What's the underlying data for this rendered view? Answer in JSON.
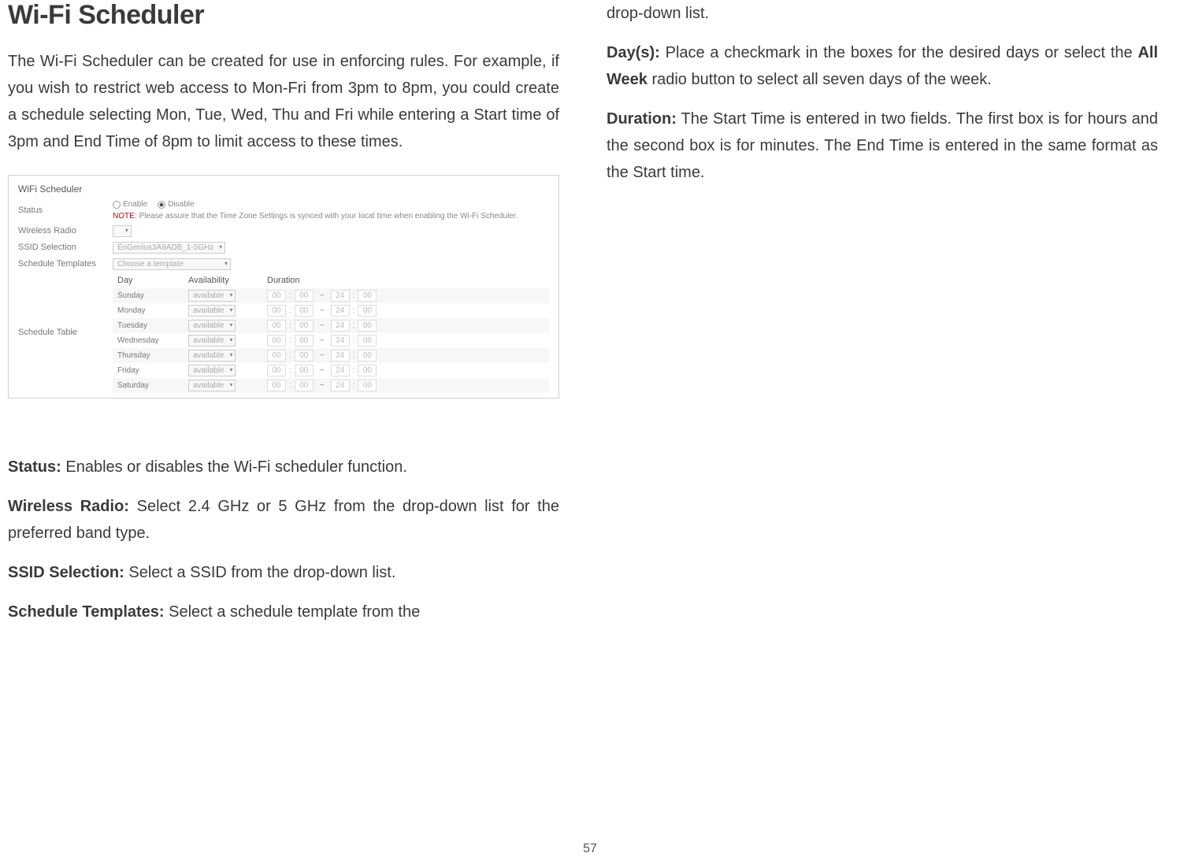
{
  "left": {
    "heading": "Wi-Fi Scheduler",
    "intro": "The Wi-Fi Scheduler can be created for use in enforcing rules. For example, if you wish to restrict web access to Mon-Fri from 3pm to 8pm, you could create a schedule selecting Mon, Tue, Wed, Thu and Fri while entering a Start time of 3pm and End Time of 8pm to limit access to these times.",
    "status_label": "Status:",
    "status_text": " Enables or disables the Wi-Fi scheduler function.",
    "wireless_label": "Wireless Radio:",
    "wireless_text": " Select 2.4 GHz or 5 GHz from the drop-down list for the preferred band type.",
    "ssid_label": "SSID Selection:",
    "ssid_text": " Select a SSID from the drop-down list.",
    "templates_label": "Schedule Templates:",
    "templates_text": " Select a schedule template from the "
  },
  "right": {
    "dropdown_cont": "drop-down list.",
    "days_label": "Day(s):",
    "days_text_1": " Place a checkmark in the boxes for the desired days or select the ",
    "days_bold": "All Week",
    "days_text_2": " radio button to select all seven days of the week.",
    "duration_label": "Duration:",
    "duration_text": " The Start Time is entered in two fields. The first box is for hours and the second box is for minutes. The End Time is entered in the same format as the Start time."
  },
  "screenshot": {
    "title": "WiFi Scheduler",
    "labels": {
      "status": "Status",
      "wireless": "Wireless Radio",
      "ssid": "SSID Selection",
      "templates": "Schedule Templates",
      "table": "Schedule Table"
    },
    "radios": {
      "enable": "Enable",
      "disable": "Disable"
    },
    "note_prefix": "NOTE:",
    "note": "  Please assure that the Time Zone Settings is synced with your local time when enabling the Wi-Fi Scheduler.",
    "ssid_value": "EnGenius3A9ADB_1-5GHz",
    "template_value": "Choose a template",
    "headers": {
      "day": "Day",
      "avail": "Availability",
      "dur": "Duration"
    },
    "rows": [
      {
        "day": "Sunday",
        "avail": "available",
        "sh": "00",
        "sm": "00",
        "eh": "24",
        "em": "00"
      },
      {
        "day": "Monday",
        "avail": "available",
        "sh": "00",
        "sm": "00",
        "eh": "24",
        "em": "00"
      },
      {
        "day": "Tuesday",
        "avail": "available",
        "sh": "00",
        "sm": "00",
        "eh": "24",
        "em": "00"
      },
      {
        "day": "Wednesday",
        "avail": "available",
        "sh": "00",
        "sm": "00",
        "eh": "24",
        "em": "00"
      },
      {
        "day": "Thursday",
        "avail": "available",
        "sh": "00",
        "sm": "00",
        "eh": "24",
        "em": "00"
      },
      {
        "day": "Friday",
        "avail": "available",
        "sh": "00",
        "sm": "00",
        "eh": "24",
        "em": "00"
      },
      {
        "day": "Saturday",
        "avail": "available",
        "sh": "00",
        "sm": "00",
        "eh": "24",
        "em": "00"
      }
    ]
  },
  "page_number": "57"
}
